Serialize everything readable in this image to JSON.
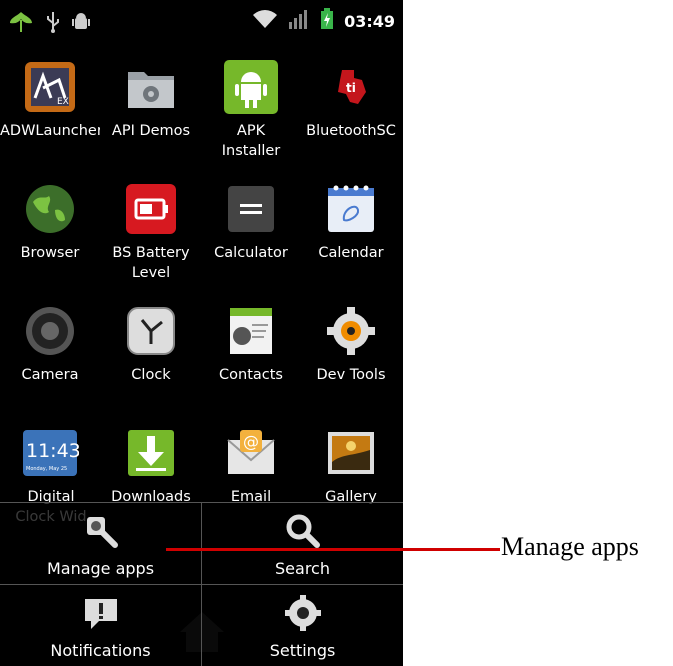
{
  "status_bar": {
    "time": "03:49",
    "icons": [
      "leaf-notification-icon",
      "usb-icon",
      "android-debug-icon",
      "wifi-icon",
      "signal-icon",
      "battery-charging-icon"
    ]
  },
  "apps": [
    {
      "label": "ADWLauncher",
      "icon": "adwlauncher-icon"
    },
    {
      "label": "API Demos",
      "icon": "api-demos-icon"
    },
    {
      "label": "APK Installer",
      "icon": "apk-installer-icon"
    },
    {
      "label": "BluetoothSC",
      "icon": "bluetooth-sc-icon"
    },
    {
      "label": "Browser",
      "icon": "browser-icon"
    },
    {
      "label": "BS Battery Level",
      "icon": "battery-level-icon"
    },
    {
      "label": "Calculator",
      "icon": "calculator-icon"
    },
    {
      "label": "Calendar",
      "icon": "calendar-icon"
    },
    {
      "label": "Camera",
      "icon": "camera-icon"
    },
    {
      "label": "Clock",
      "icon": "clock-icon"
    },
    {
      "label": "Contacts",
      "icon": "contacts-icon"
    },
    {
      "label": "Dev Tools",
      "icon": "dev-tools-icon"
    },
    {
      "label": "Digital Clock Wid",
      "icon": "digital-clock-icon",
      "widget_time": "11:43",
      "widget_date": "Monday, May 25"
    },
    {
      "label": "Downloads",
      "icon": "downloads-icon"
    },
    {
      "label": "Email",
      "icon": "email-icon"
    },
    {
      "label": "Gallery",
      "icon": "gallery-icon"
    }
  ],
  "menu": {
    "manage_apps": "Manage apps",
    "search": "Search",
    "notifications": "Notifications",
    "settings": "Settings"
  },
  "annotation": {
    "label": "Manage apps",
    "color": "#d00000"
  }
}
